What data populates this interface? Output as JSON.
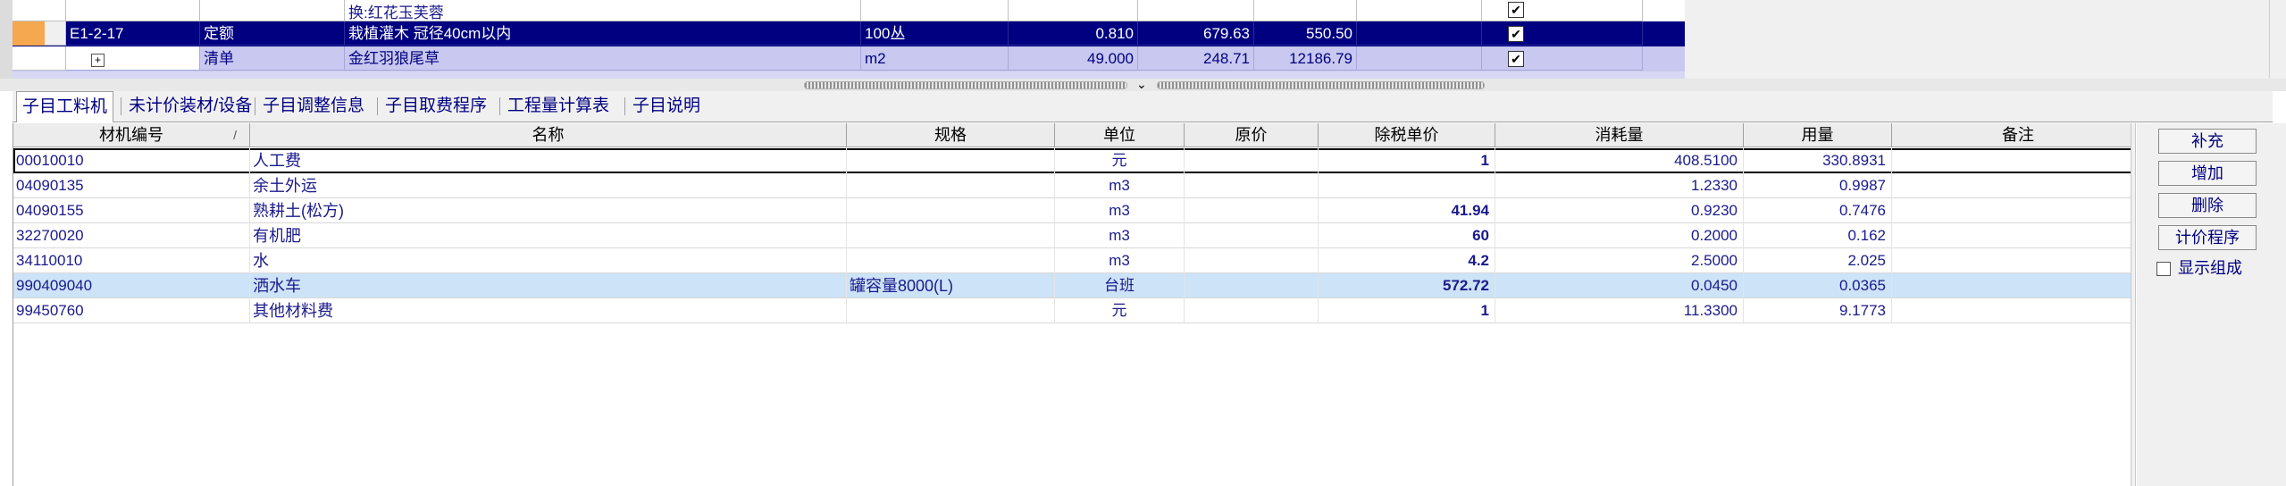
{
  "top_grid": {
    "partial_row": {
      "type": "",
      "name_line1": "",
      "name_line2": "换:红花玉芙蓉"
    },
    "selected_row": {
      "code": "E1-2-17",
      "type": "定额",
      "name": "栽植灌木 冠径40cm以内",
      "unit": "100丛",
      "qty": "0.810",
      "price": "679.63",
      "total": "550.50"
    },
    "light_row": {
      "expand": "+",
      "type": "清单",
      "name": "金红羽狼尾草",
      "unit": "m2",
      "qty": "49.000",
      "price": "248.71",
      "total": "12186.79"
    }
  },
  "tabs": [
    {
      "label": "子目工料机"
    },
    {
      "label": "未计价装材/设备"
    },
    {
      "label": "子目调整信息"
    },
    {
      "label": "子目取费程序"
    },
    {
      "label": "工程量计算表"
    },
    {
      "label": "子目说明"
    }
  ],
  "grid": {
    "headers": {
      "code": "材机编号",
      "sort_symbol": "/",
      "name": "名称",
      "spec": "规格",
      "unit": "单位",
      "orig_price": "原价",
      "tax_price": "除税单价",
      "consumption": "消耗量",
      "usage": "用量",
      "remark": "备注"
    },
    "rows": [
      {
        "code": "00010010",
        "name": "人工费",
        "spec": "",
        "unit": "元",
        "orig_price": "",
        "tax_price": "1",
        "consumption": "408.5100",
        "usage": "330.8931",
        "remark": ""
      },
      {
        "code": "04090135",
        "name": "余土外运",
        "spec": "",
        "unit": "m3",
        "orig_price": "",
        "tax_price": "",
        "consumption": "1.2330",
        "usage": "0.9987",
        "remark": ""
      },
      {
        "code": "04090155",
        "name": "熟耕土(松方)",
        "spec": "",
        "unit": "m3",
        "orig_price": "",
        "tax_price": "41.94",
        "consumption": "0.9230",
        "usage": "0.7476",
        "remark": ""
      },
      {
        "code": "32270020",
        "name": "有机肥",
        "spec": "",
        "unit": "m3",
        "orig_price": "",
        "tax_price": "60",
        "consumption": "0.2000",
        "usage": "0.162",
        "remark": ""
      },
      {
        "code": "34110010",
        "name": "水",
        "spec": "",
        "unit": "m3",
        "orig_price": "",
        "tax_price": "4.2",
        "consumption": "2.5000",
        "usage": "2.025",
        "remark": ""
      },
      {
        "code": "990409040",
        "name": "洒水车",
        "spec": "罐容量8000(L)",
        "unit": "台班",
        "orig_price": "",
        "tax_price": "572.72",
        "consumption": "0.0450",
        "usage": "0.0365",
        "remark": ""
      },
      {
        "code": "99450760",
        "name": "其他材料费",
        "spec": "",
        "unit": "元",
        "orig_price": "",
        "tax_price": "1",
        "consumption": "11.3300",
        "usage": "9.1773",
        "remark": ""
      }
    ]
  },
  "right_panel": {
    "buttons": [
      "补充",
      "增加",
      "删除",
      "计价程序"
    ],
    "show_composition": "显示组成"
  },
  "colors": {
    "selected_row": "#000080",
    "highlight_row": "#cde3f7",
    "text_blue": "#1a1a8c"
  }
}
